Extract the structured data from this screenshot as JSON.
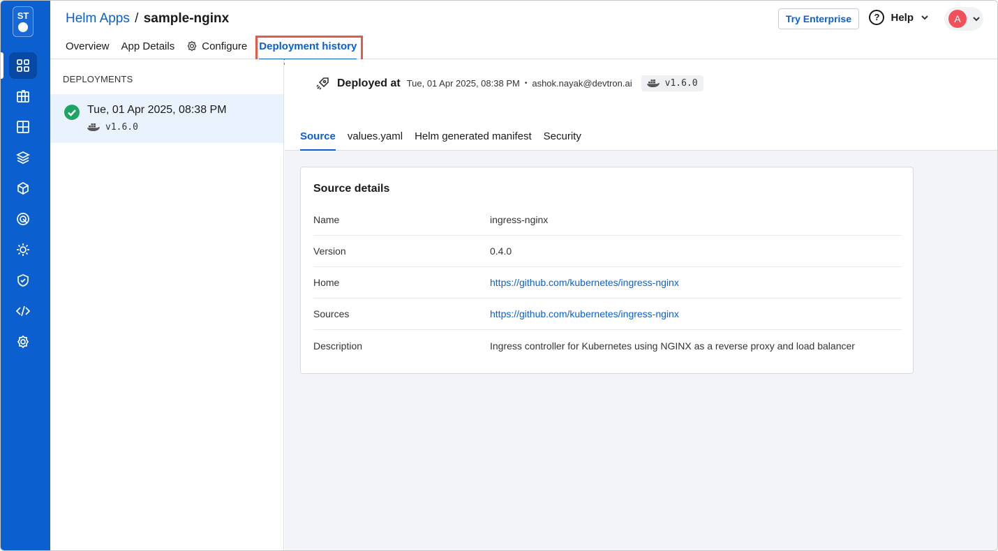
{
  "logo": {
    "text": "ST"
  },
  "rail": {
    "items": [
      {
        "icon": "apps-grid-icon",
        "active": true
      },
      {
        "icon": "resource-browser-icon"
      },
      {
        "icon": "app-groups-icon"
      },
      {
        "icon": "chart-store-icon"
      },
      {
        "icon": "deployment-charts-icon"
      },
      {
        "icon": "security-scan-icon"
      },
      {
        "icon": "bulk-edit-icon"
      },
      {
        "icon": "security-shield-icon"
      },
      {
        "icon": "code-icon"
      },
      {
        "icon": "global-config-icon"
      }
    ]
  },
  "header": {
    "breadcrumb_parent": "Helm Apps",
    "breadcrumb_sep": "/",
    "breadcrumb_current": "sample-nginx",
    "tabs": [
      {
        "label": "Overview"
      },
      {
        "label": "App Details"
      },
      {
        "label": "Configure",
        "icon": "gear-icon"
      },
      {
        "label": "Deployment history",
        "active": true
      }
    ],
    "try_enterprise": "Try Enterprise",
    "help": "Help",
    "help_icon": "?",
    "avatar_initial": "A"
  },
  "deployments": {
    "title": "DEPLOYMENTS",
    "items": [
      {
        "date": "Tue, 01 Apr 2025, 08:38 PM",
        "tag": "v1.6.0",
        "status": "success"
      }
    ]
  },
  "detail": {
    "deployed_label": "Deployed at",
    "deployed_time": "Tue, 01 Apr 2025, 08:38 PM",
    "deployed_user": "ashok.nayak@devtron.ai",
    "dot": "•",
    "tag": "v1.6.0",
    "tabs": [
      {
        "label": "Source",
        "active": true
      },
      {
        "label": "values.yaml"
      },
      {
        "label": "Helm generated manifest"
      },
      {
        "label": "Security"
      }
    ]
  },
  "source_details": {
    "title": "Source details",
    "rows": [
      {
        "key": "Name",
        "value": "ingress-nginx"
      },
      {
        "key": "Version",
        "value": "0.4.0"
      },
      {
        "key": "Home",
        "value": "https://github.com/kubernetes/ingress-nginx",
        "link": true
      },
      {
        "key": "Sources",
        "value": "https://github.com/kubernetes/ingress-nginx",
        "link": true
      },
      {
        "key": "Description",
        "value": "Ingress controller for Kubernetes using NGINX as a reverse proxy and load balancer"
      }
    ]
  },
  "colors": {
    "rail": "#0b5fcf",
    "accent": "#0b5fcf",
    "success": "#1ea564",
    "highlight": "#e15a4a",
    "avatar": "#f0505a"
  }
}
